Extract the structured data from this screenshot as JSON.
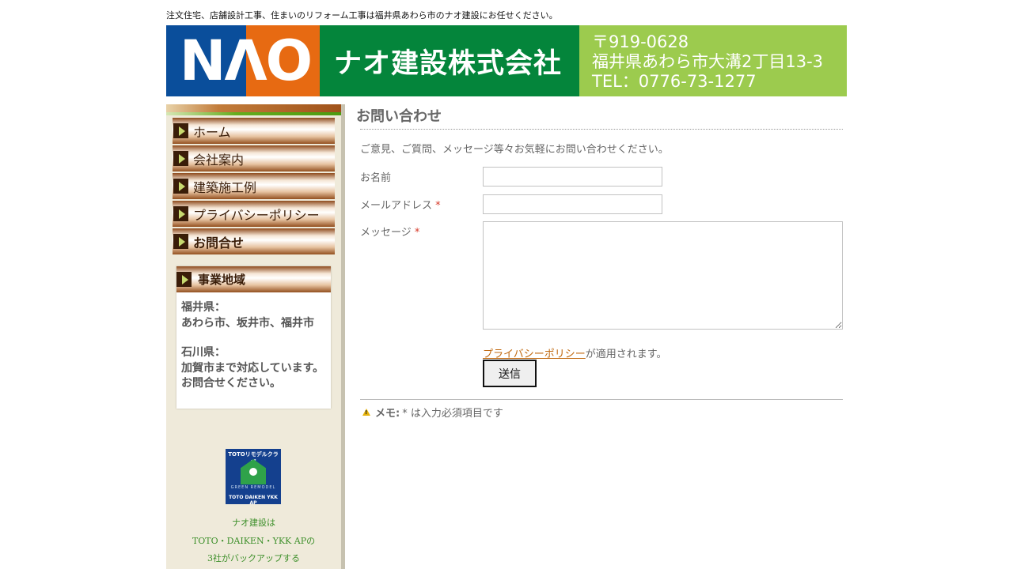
{
  "tagline": "注文住宅、店舗設計工事、住まいのリフォーム工事は福井県あわら市のナオ建設にお任せください。",
  "header": {
    "logo_text": "NΛO",
    "company_name": "ナオ建設株式会社",
    "postal": "〒919-0628",
    "address": "福井県あわら市大溝2丁目13-3",
    "tel": "TEL：0776-73-1277",
    "colors": {
      "blue": "#0a4e9b",
      "orange": "#e76a12",
      "green": "#04853b",
      "light_green": "#9ccb4e"
    }
  },
  "sidebar": {
    "nav": [
      {
        "label": "ホーム",
        "active": false
      },
      {
        "label": "会社案内",
        "active": false
      },
      {
        "label": "建築施工例",
        "active": false
      },
      {
        "label": "プライバシーポリシー",
        "active": false
      },
      {
        "label": "お問合せ",
        "active": true
      }
    ],
    "area": {
      "title": "事業地域",
      "lines": [
        "福井県：",
        "あわら市、坂井市、福井市",
        "",
        "石川県：",
        "加賀市まで対応しています。",
        "お問合せください。"
      ]
    },
    "badge": {
      "top": "TOTOリモデルクラブ",
      "sub": "GREEN REMODEL",
      "bottom": "TOTO DAIKEN YKK AP"
    },
    "sponsor_lines": [
      "ナオ建設は",
      "TOTO・DAIKEN・YKK APの",
      "3社がバックアップする"
    ]
  },
  "main": {
    "title": "お問い合わせ",
    "intro": "ご意見、ご質問、メッセージ等々お気軽にお問い合わせください。",
    "fields": {
      "name_label": "お名前",
      "email_label": "メールアドレス",
      "message_label": "メッセージ",
      "required_mark": "*",
      "name_value": "",
      "email_value": "",
      "message_value": ""
    },
    "privacy_link": "プライバシーポリシー",
    "privacy_suffix": "が適用されます。",
    "submit_label": "送信",
    "memo_strong": "メモ:",
    "memo_text": "* は入力必須項目です"
  }
}
